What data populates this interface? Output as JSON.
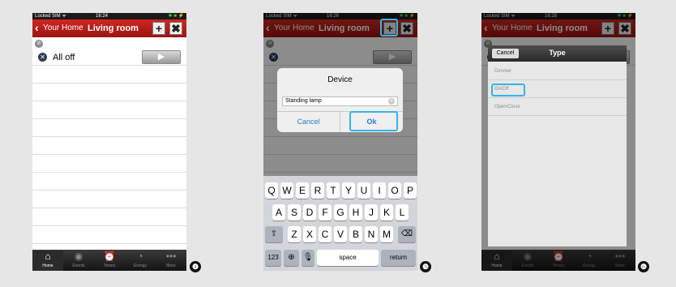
{
  "status": {
    "carrier": "Locked SIM ᯤ",
    "battery": "✱ ■ ⚡"
  },
  "screens": [
    {
      "time": "16:24",
      "back": "Your Home",
      "title": "Living room",
      "step": "❹"
    },
    {
      "time": "16:26",
      "back": "Your Home",
      "title": "Living room",
      "step": "❺"
    },
    {
      "time": "16:28",
      "back": "Your Home",
      "title": "Living room",
      "step": "❻"
    }
  ],
  "list": {
    "item_label": "All off"
  },
  "tabs": [
    {
      "label": "Home",
      "icon": "home-icon"
    },
    {
      "label": "Events",
      "icon": "play-circle-icon"
    },
    {
      "label": "Timers",
      "icon": "alarm-clock-icon"
    },
    {
      "label": "Energy",
      "icon": "gauge-icon"
    },
    {
      "label": "More",
      "icon": "more-dots-icon"
    }
  ],
  "dialog": {
    "title": "Device",
    "input_value": "Standing lamp",
    "cancel": "Cancel",
    "ok": "Ok"
  },
  "keyboard": {
    "row1": [
      "Q",
      "W",
      "E",
      "R",
      "T",
      "Y",
      "U",
      "I",
      "O",
      "P"
    ],
    "row2": [
      "A",
      "S",
      "D",
      "F",
      "G",
      "H",
      "J",
      "K",
      "L"
    ],
    "row3": [
      "Z",
      "X",
      "C",
      "V",
      "B",
      "N",
      "M"
    ],
    "numbers": "123",
    "space": "space",
    "return": "return"
  },
  "picker": {
    "cancel": "Cancel",
    "title": "Type",
    "options": [
      "Dimmer",
      "On/Off",
      "Open/Close"
    ]
  },
  "colors": {
    "nav_red": "#c41f18",
    "highlight": "#35b4e8",
    "link_blue": "#2a7bd4"
  }
}
